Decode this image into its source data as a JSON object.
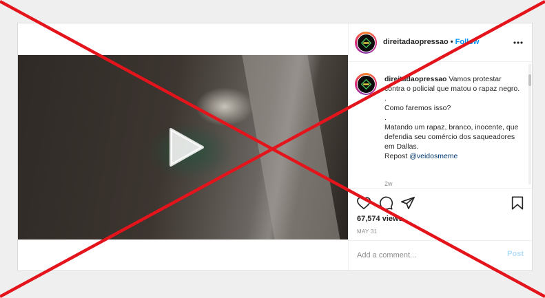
{
  "post": {
    "username": "direitadaopressao",
    "separator": "•",
    "follow_label": "Follow",
    "caption_lines": [
      "Vamos protestar contra o policial que matou o rapaz negro.",
      ".",
      "Como faremos isso?",
      ".",
      "Matando um rapaz, branco, inocente, que defendia seu comércio dos saqueadores em Dallas."
    ],
    "repost_prefix": "Repost",
    "repost_mention": "@veidosmeme",
    "time_ago": "2w",
    "views": "67,574 views",
    "date": "MAY 31",
    "comment_placeholder": "Add a comment...",
    "post_label": "Post"
  },
  "icons": {
    "more": "more-options-icon",
    "like": "heart-icon",
    "comment": "comment-icon",
    "share": "share-icon",
    "save": "bookmark-icon",
    "play": "play-icon"
  },
  "colors": {
    "link_blue": "#0095f6",
    "overlay_red": "#e3141b",
    "muted": "#8e8e8e"
  }
}
